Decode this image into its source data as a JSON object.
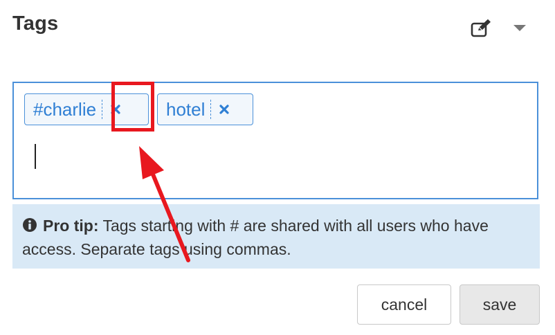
{
  "panel": {
    "title": "Tags",
    "edit_icon": "edit-icon",
    "menu_icon": "caret-down-icon"
  },
  "tags": [
    {
      "label": "#charlie",
      "remove_icon": "close-icon"
    },
    {
      "label": "hotel",
      "remove_icon": "close-icon"
    }
  ],
  "tip": {
    "icon": "info-icon",
    "label": "Pro tip:",
    "text": " Tags starting with # are shared with all users who have access. Separate tags using commas."
  },
  "buttons": {
    "cancel": "cancel",
    "save": "save"
  },
  "colors": {
    "accent": "#4a90d9",
    "tag_text": "#2f7fd4",
    "tip_background": "#d9e9f6",
    "annotation": "#e8181f"
  }
}
